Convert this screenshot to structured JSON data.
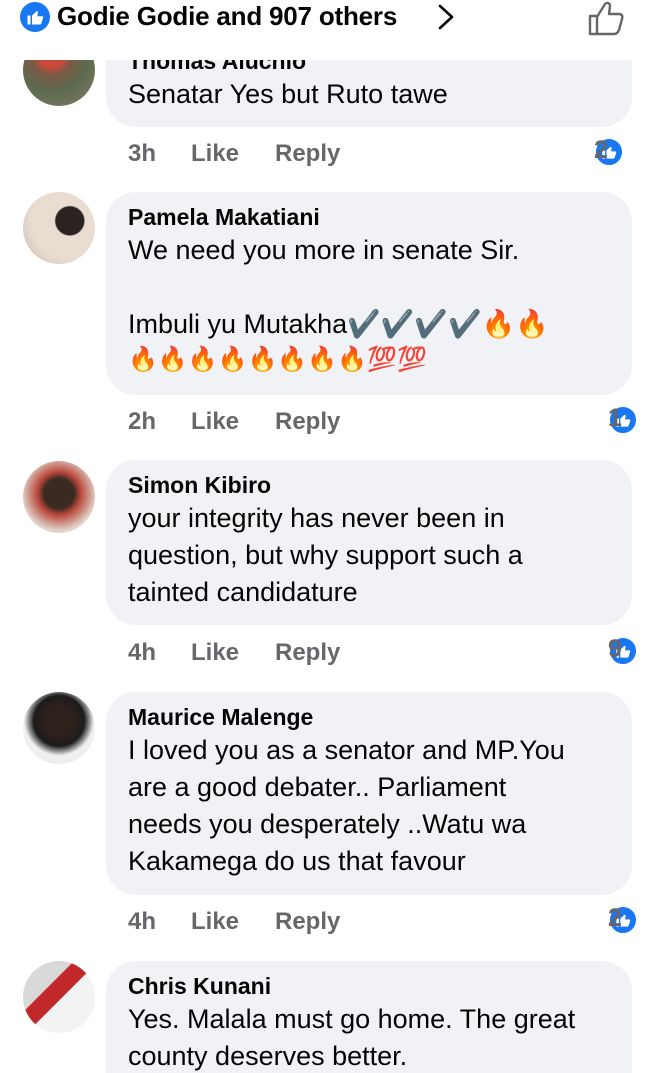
{
  "header": {
    "reactors_text": "Godie Godie and 907 others",
    "icons": {
      "reaction": "like-icon",
      "chevron": "chevron-right-icon",
      "like_button": "thumbs-up-outline-icon"
    }
  },
  "colors": {
    "accent": "#1877f2",
    "bubble": "#f0f2f5",
    "muted": "#65676b"
  },
  "comments": [
    {
      "author": "Thomas Aluchio",
      "text": "Senatar Yes but Ruto tawe",
      "time": "3h",
      "like_label": "Like",
      "reply_label": "Reply",
      "reactions": "2"
    },
    {
      "author": "Pamela Makatiani",
      "text": "We need you more in senate Sir.\n\nImbuli yu Mutakha✔️✔️✔️✔️🔥🔥",
      "emoji_line": "🔥🔥🔥🔥🔥🔥🔥🔥💯💯",
      "time": "2h",
      "like_label": "Like",
      "reply_label": "Reply",
      "reactions": "1"
    },
    {
      "author": "Simon Kibiro",
      "text": "your integrity has never been in\nquestion, but why support such a\ntainted candidature",
      "time": "4h",
      "like_label": "Like",
      "reply_label": "Reply",
      "reactions": "9"
    },
    {
      "author": "Maurice Malenge",
      "text": "I loved you as a senator and MP.You\nare a good debater.. Parliament\nneeds you desperately ..Watu wa\nKakamega do us that favour",
      "time": "4h",
      "like_label": "Like",
      "reply_label": "Reply",
      "reactions": "2"
    },
    {
      "author": "Chris Kunani",
      "text": "Yes. Malala must go home. The great\ncounty deserves better."
    }
  ]
}
